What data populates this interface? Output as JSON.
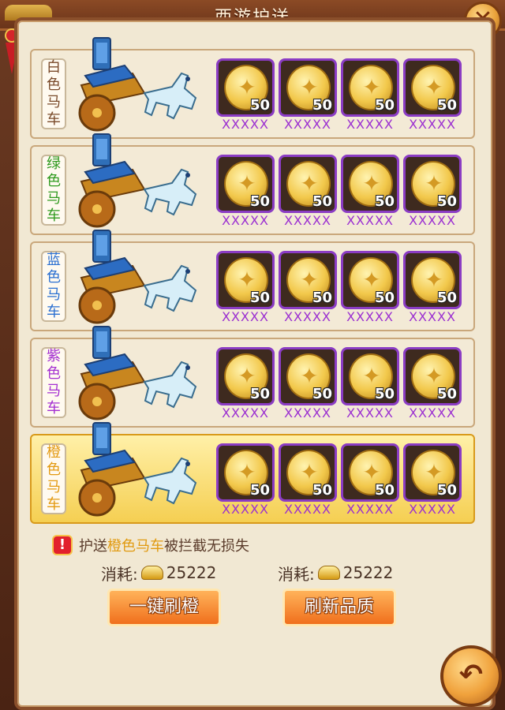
{
  "window": {
    "title": "西游护送"
  },
  "carriages": [
    {
      "label_chars": [
        "白",
        "色",
        "马",
        "车"
      ],
      "label_color": "#7a4a2a",
      "selected": false,
      "items": [
        {
          "qty": "50",
          "name": "XXXXX"
        },
        {
          "qty": "50",
          "name": "XXXXX"
        },
        {
          "qty": "50",
          "name": "XXXXX"
        },
        {
          "qty": "50",
          "name": "XXXXX"
        }
      ]
    },
    {
      "label_chars": [
        "绿",
        "色",
        "马",
        "车"
      ],
      "label_color": "#2f9a1e",
      "selected": false,
      "items": [
        {
          "qty": "50",
          "name": "XXXXX"
        },
        {
          "qty": "50",
          "name": "XXXXX"
        },
        {
          "qty": "50",
          "name": "XXXXX"
        },
        {
          "qty": "50",
          "name": "XXXXX"
        }
      ]
    },
    {
      "label_chars": [
        "蓝",
        "色",
        "马",
        "车"
      ],
      "label_color": "#2a6fd1",
      "selected": false,
      "items": [
        {
          "qty": "50",
          "name": "XXXXX"
        },
        {
          "qty": "50",
          "name": "XXXXX"
        },
        {
          "qty": "50",
          "name": "XXXXX"
        },
        {
          "qty": "50",
          "name": "XXXXX"
        }
      ]
    },
    {
      "label_chars": [
        "紫",
        "色",
        "马",
        "车"
      ],
      "label_color": "#a42fd1",
      "selected": false,
      "items": [
        {
          "qty": "50",
          "name": "XXXXX"
        },
        {
          "qty": "50",
          "name": "XXXXX"
        },
        {
          "qty": "50",
          "name": "XXXXX"
        },
        {
          "qty": "50",
          "name": "XXXXX"
        }
      ]
    },
    {
      "label_chars": [
        "橙",
        "色",
        "马",
        "车"
      ],
      "label_color": "#e39a12",
      "selected": true,
      "items": [
        {
          "qty": "50",
          "name": "XXXXX"
        },
        {
          "qty": "50",
          "name": "XXXXX"
        },
        {
          "qty": "50",
          "name": "XXXXX"
        },
        {
          "qty": "50",
          "name": "XXXXX"
        }
      ]
    }
  ],
  "notice": {
    "prefix": "护送",
    "highlight": "橙色马车",
    "suffix": "被拦截无损失",
    "highlight_color": "#e19a10"
  },
  "costs": [
    {
      "label": "消耗:",
      "amount": "25222"
    },
    {
      "label": "消耗:",
      "amount": "25222"
    }
  ],
  "buttons": {
    "one_click_orange": "一键刷橙",
    "refresh_quality": "刷新品质"
  },
  "icons": {
    "close": "close-icon",
    "back": "back-arrow-icon",
    "warning": "exclamation-icon",
    "currency": "gold-ingot-icon",
    "item": "gold-coin-icon"
  }
}
